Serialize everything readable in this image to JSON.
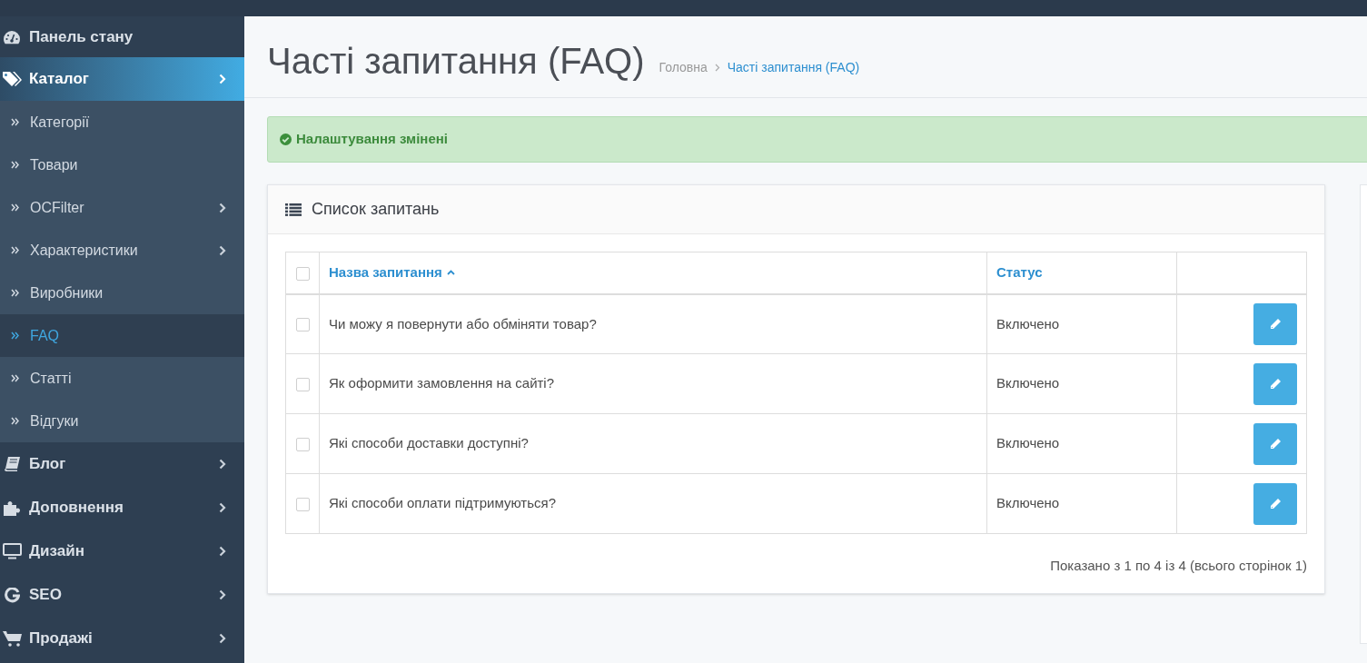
{
  "sidebar": {
    "items": [
      {
        "label": "Панель стану",
        "selected": false,
        "has_submenu": false
      },
      {
        "label": "Каталог",
        "selected": true,
        "has_submenu": true,
        "expanded": true,
        "children": [
          {
            "label": "Категорії",
            "selected": false,
            "has_submenu": false
          },
          {
            "label": "Товари",
            "selected": false,
            "has_submenu": false
          },
          {
            "label": "OCFilter",
            "selected": false,
            "has_submenu": true
          },
          {
            "label": "Характеристики",
            "selected": false,
            "has_submenu": true
          },
          {
            "label": "Виробники",
            "selected": false,
            "has_submenu": false
          },
          {
            "label": "FAQ",
            "selected": true,
            "has_submenu": false
          },
          {
            "label": "Статті",
            "selected": false,
            "has_submenu": false
          },
          {
            "label": "Відгуки",
            "selected": false,
            "has_submenu": false
          }
        ]
      },
      {
        "label": "Блог",
        "selected": false,
        "has_submenu": true,
        "expanded": false
      },
      {
        "label": "Доповнення",
        "selected": false,
        "has_submenu": true,
        "expanded": false
      },
      {
        "label": "Дизайн",
        "selected": false,
        "has_submenu": true,
        "expanded": false
      },
      {
        "label": "SEO",
        "selected": false,
        "has_submenu": true,
        "expanded": false
      },
      {
        "label": "Продажі",
        "selected": false,
        "has_submenu": true,
        "expanded": false
      }
    ]
  },
  "page": {
    "title": "Часті запитання (FAQ)",
    "breadcrumbs": [
      {
        "label": "Головна",
        "selected": false
      },
      {
        "label": "Часті запитання (FAQ)",
        "selected": true
      }
    ]
  },
  "alert": {
    "text": "Налаштування змінені"
  },
  "panel": {
    "title": "Список запитань",
    "table": {
      "select_all": {
        "checked": false
      },
      "columns": [
        {
          "label": "Назва запитання",
          "sorted": true
        },
        {
          "label": "Статус",
          "sorted": false
        }
      ],
      "rows": [
        {
          "checked": false,
          "question": "Чи можу я повернути або обміняти товар?",
          "status": "Включено"
        },
        {
          "checked": false,
          "question": "Як оформити замовлення на сайті?",
          "status": "Включено"
        },
        {
          "checked": false,
          "question": "Які способи доставки доступні?",
          "status": "Включено"
        },
        {
          "checked": false,
          "question": "Які способи оплати підтримуються?",
          "status": "Включено"
        }
      ]
    },
    "pagination_text": "Показано з 1 по 4 із 4 (всього сторінок 1)"
  }
}
